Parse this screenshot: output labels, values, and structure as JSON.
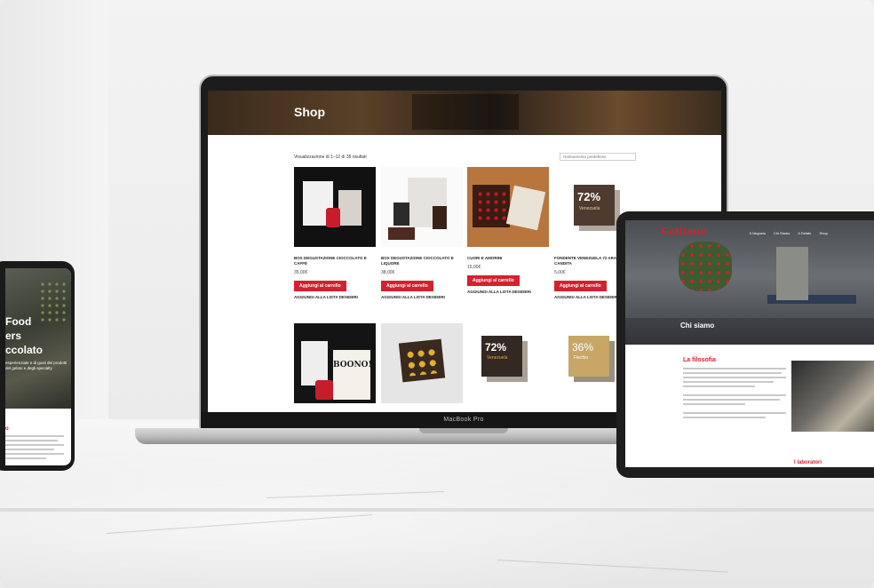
{
  "laptop": {
    "brand_label": "MacBook Pro",
    "shop": {
      "title": "Shop",
      "result_count": "Visualizzazione di 1–12 di 35 risultati",
      "sort_label": "Ordinamento predefinito"
    },
    "products": [
      {
        "name": "BOX DEGUSTAZIONE CIOCCOLATO E CAFFÈ",
        "price": "35,00€",
        "cart": "Aggiungi al carrello",
        "wish": "AGGIUNGI ALLA LISTA DESIDERI"
      },
      {
        "name": "BOX DEGUSTAZIONE CIOCCOLATO E LIQUORE",
        "price": "38,00€",
        "cart": "Aggiungi al carrello",
        "wish": "AGGIUNGI ALLA LISTA DESIDERI"
      },
      {
        "name": "CUORI E AMORINI",
        "price": "15,00€",
        "cart": "Aggiungi al carrello",
        "wish": "AGGIUNGI ALLA LISTA DESIDERI"
      },
      {
        "name": "FONDENTE VENEZUELA 72 ARANCIA CANDITA",
        "price": "5,00€",
        "cart": "Aggiungi al carrello",
        "wish": "AGGIUNGI ALLA LISTA DESIDERI"
      }
    ],
    "product_images": [
      {
        "caption": ""
      },
      {
        "caption": "BOONO!"
      },
      {
        "caption": ""
      },
      {
        "caption": "72%",
        "sub": "Venezuela"
      },
      {
        "caption": "36%",
        "sub": "Fiechio"
      },
      {
        "caption": "72%",
        "sub": "Venezuela"
      }
    ]
  },
  "tablet": {
    "logo": "Galliano",
    "nav": [
      "Il Negozio",
      "Chi Siamo",
      "Il Gelato",
      "Shop"
    ],
    "hero_title": "Chi siamo",
    "section_title": "La filosofia",
    "section2_title": "I laboratori"
  },
  "phone": {
    "title_lines": [
      "Food",
      "ers",
      "ccolato"
    ],
    "sub": "esperienziale e di gusti dei prodotti del gelato e degli specialty",
    "red_text": "o"
  },
  "colors": {
    "accent": "#d3212f",
    "hero_dark": "#3a2a1c"
  }
}
